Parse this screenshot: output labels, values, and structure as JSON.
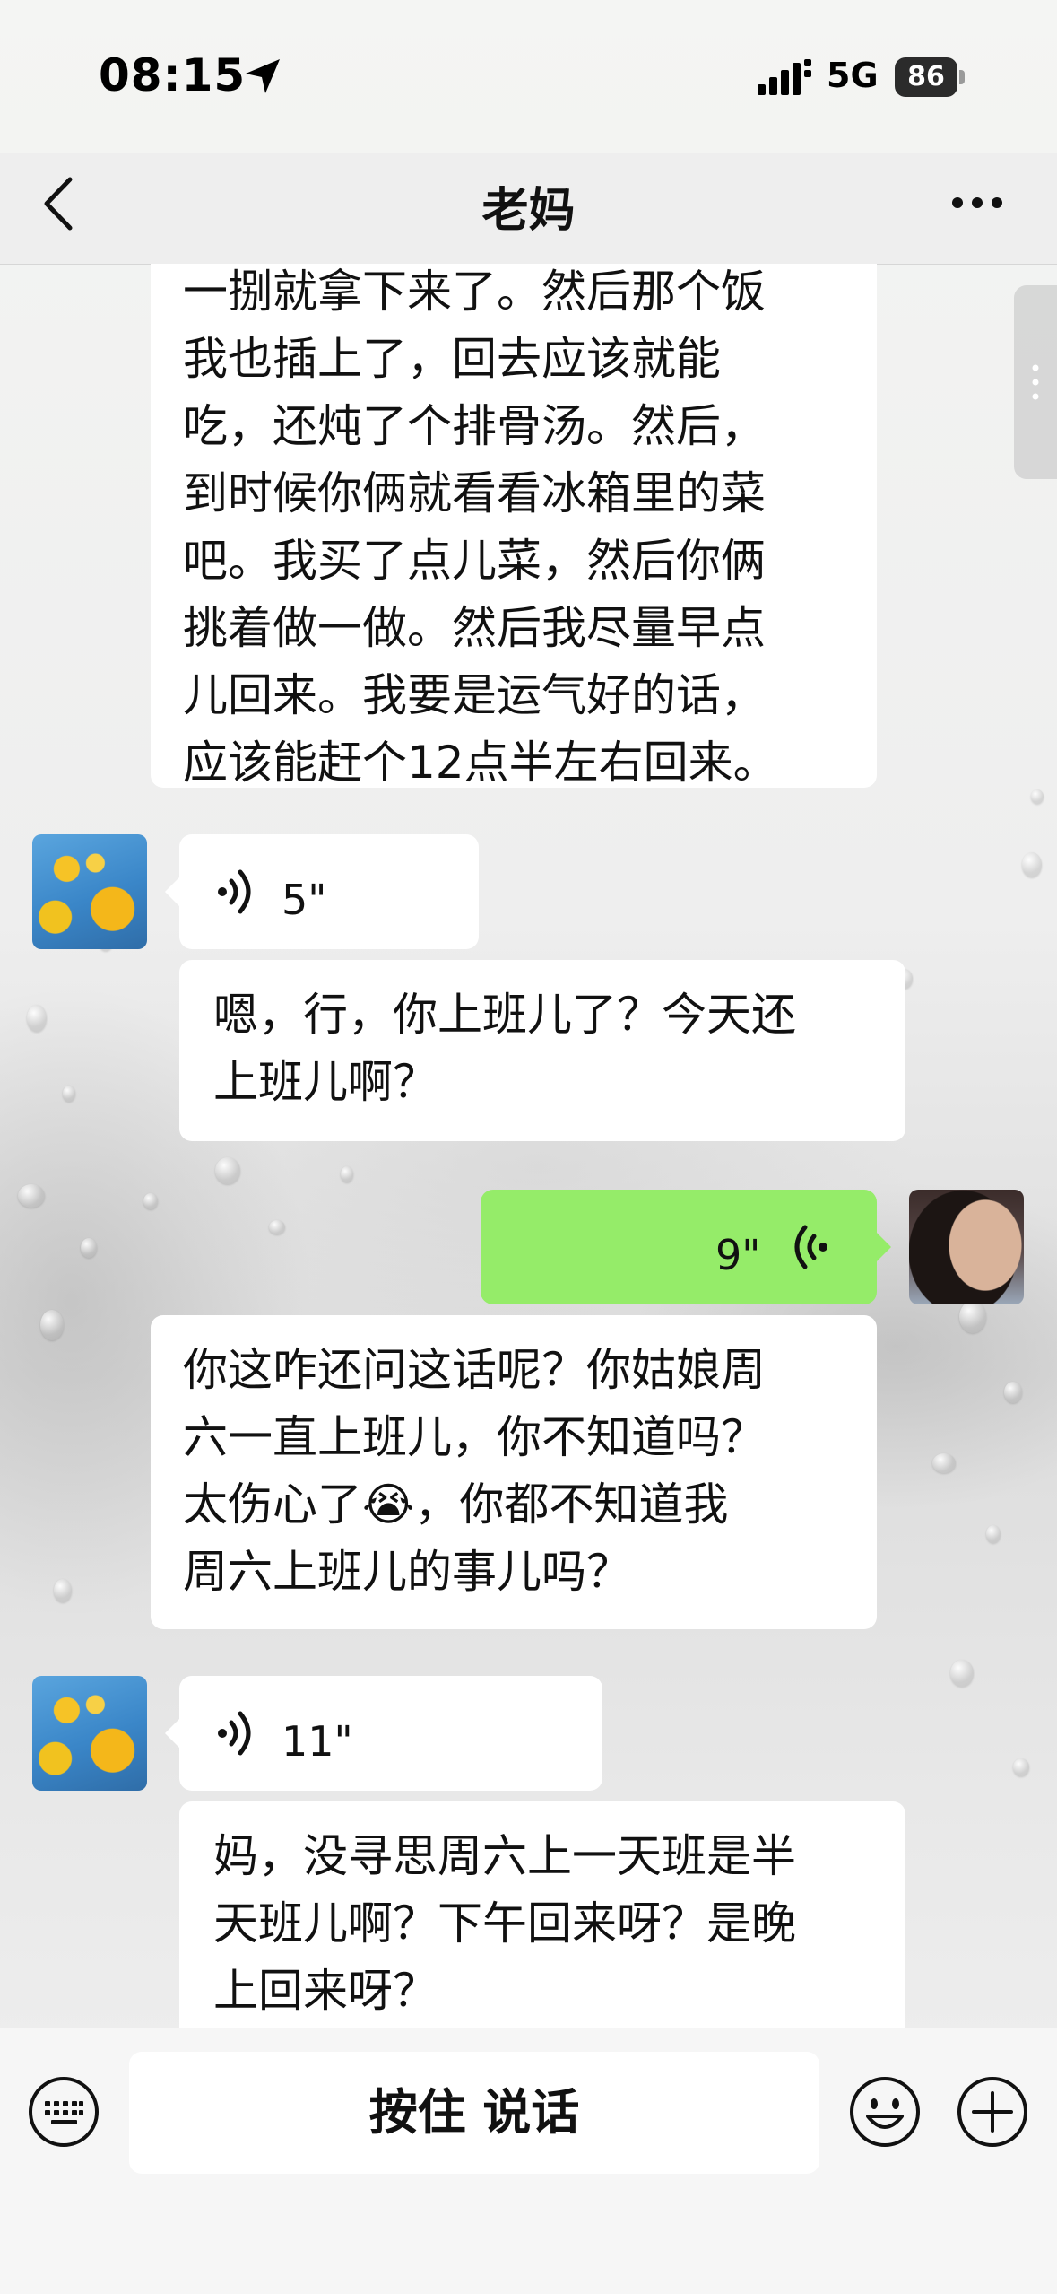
{
  "status_bar": {
    "time": "08:15",
    "network": "5G",
    "battery": "86"
  },
  "nav": {
    "title": "老妈"
  },
  "messages": [
    {
      "sender": "me",
      "type": "text",
      "lines": [
        "一捌就拿下来了。然后那个饭",
        "我也插上了，回去应该就能",
        "吃，还炖了个排骨汤。然后，",
        "到时候你俩就看看冰箱里的菜",
        "吧。我买了点儿菜，然后你俩",
        "挑着做一做。然后我尽量早点",
        "儿回来。我要是运气好的话，",
        "应该能赶个12点半左右回来。"
      ]
    },
    {
      "sender": "mom",
      "type": "voice",
      "duration": "5\"",
      "transcript_lines": [
        "嗯，行，你上班儿了？今天还",
        "上班儿啊？"
      ]
    },
    {
      "sender": "me",
      "type": "voice",
      "duration": "9\""
    },
    {
      "sender": "me",
      "type": "text",
      "lines": [
        "你这咋还问这话呢？你姑娘周",
        "六一直上班儿，你不知道吗？",
        "太伤心了😭，你都不知道我",
        "周六上班儿的事儿吗？"
      ]
    },
    {
      "sender": "mom",
      "type": "voice",
      "duration": "11\"",
      "transcript_lines": [
        "妈，没寻思周六上一天班是半",
        "天班儿啊？下午回来呀？是晚",
        "上回来呀？"
      ]
    }
  ],
  "input_bar": {
    "hold_to_talk_label": "按住 说话"
  },
  "colors": {
    "green_bubble": "#95ec69",
    "white_bubble": "#ffffff"
  },
  "icons": [
    "location-arrow-icon",
    "signal-icon",
    "battery-icon",
    "back-chevron-icon",
    "more-dots-icon",
    "voice-wave-icon",
    "keyboard-icon",
    "emoji-icon",
    "plus-icon"
  ]
}
